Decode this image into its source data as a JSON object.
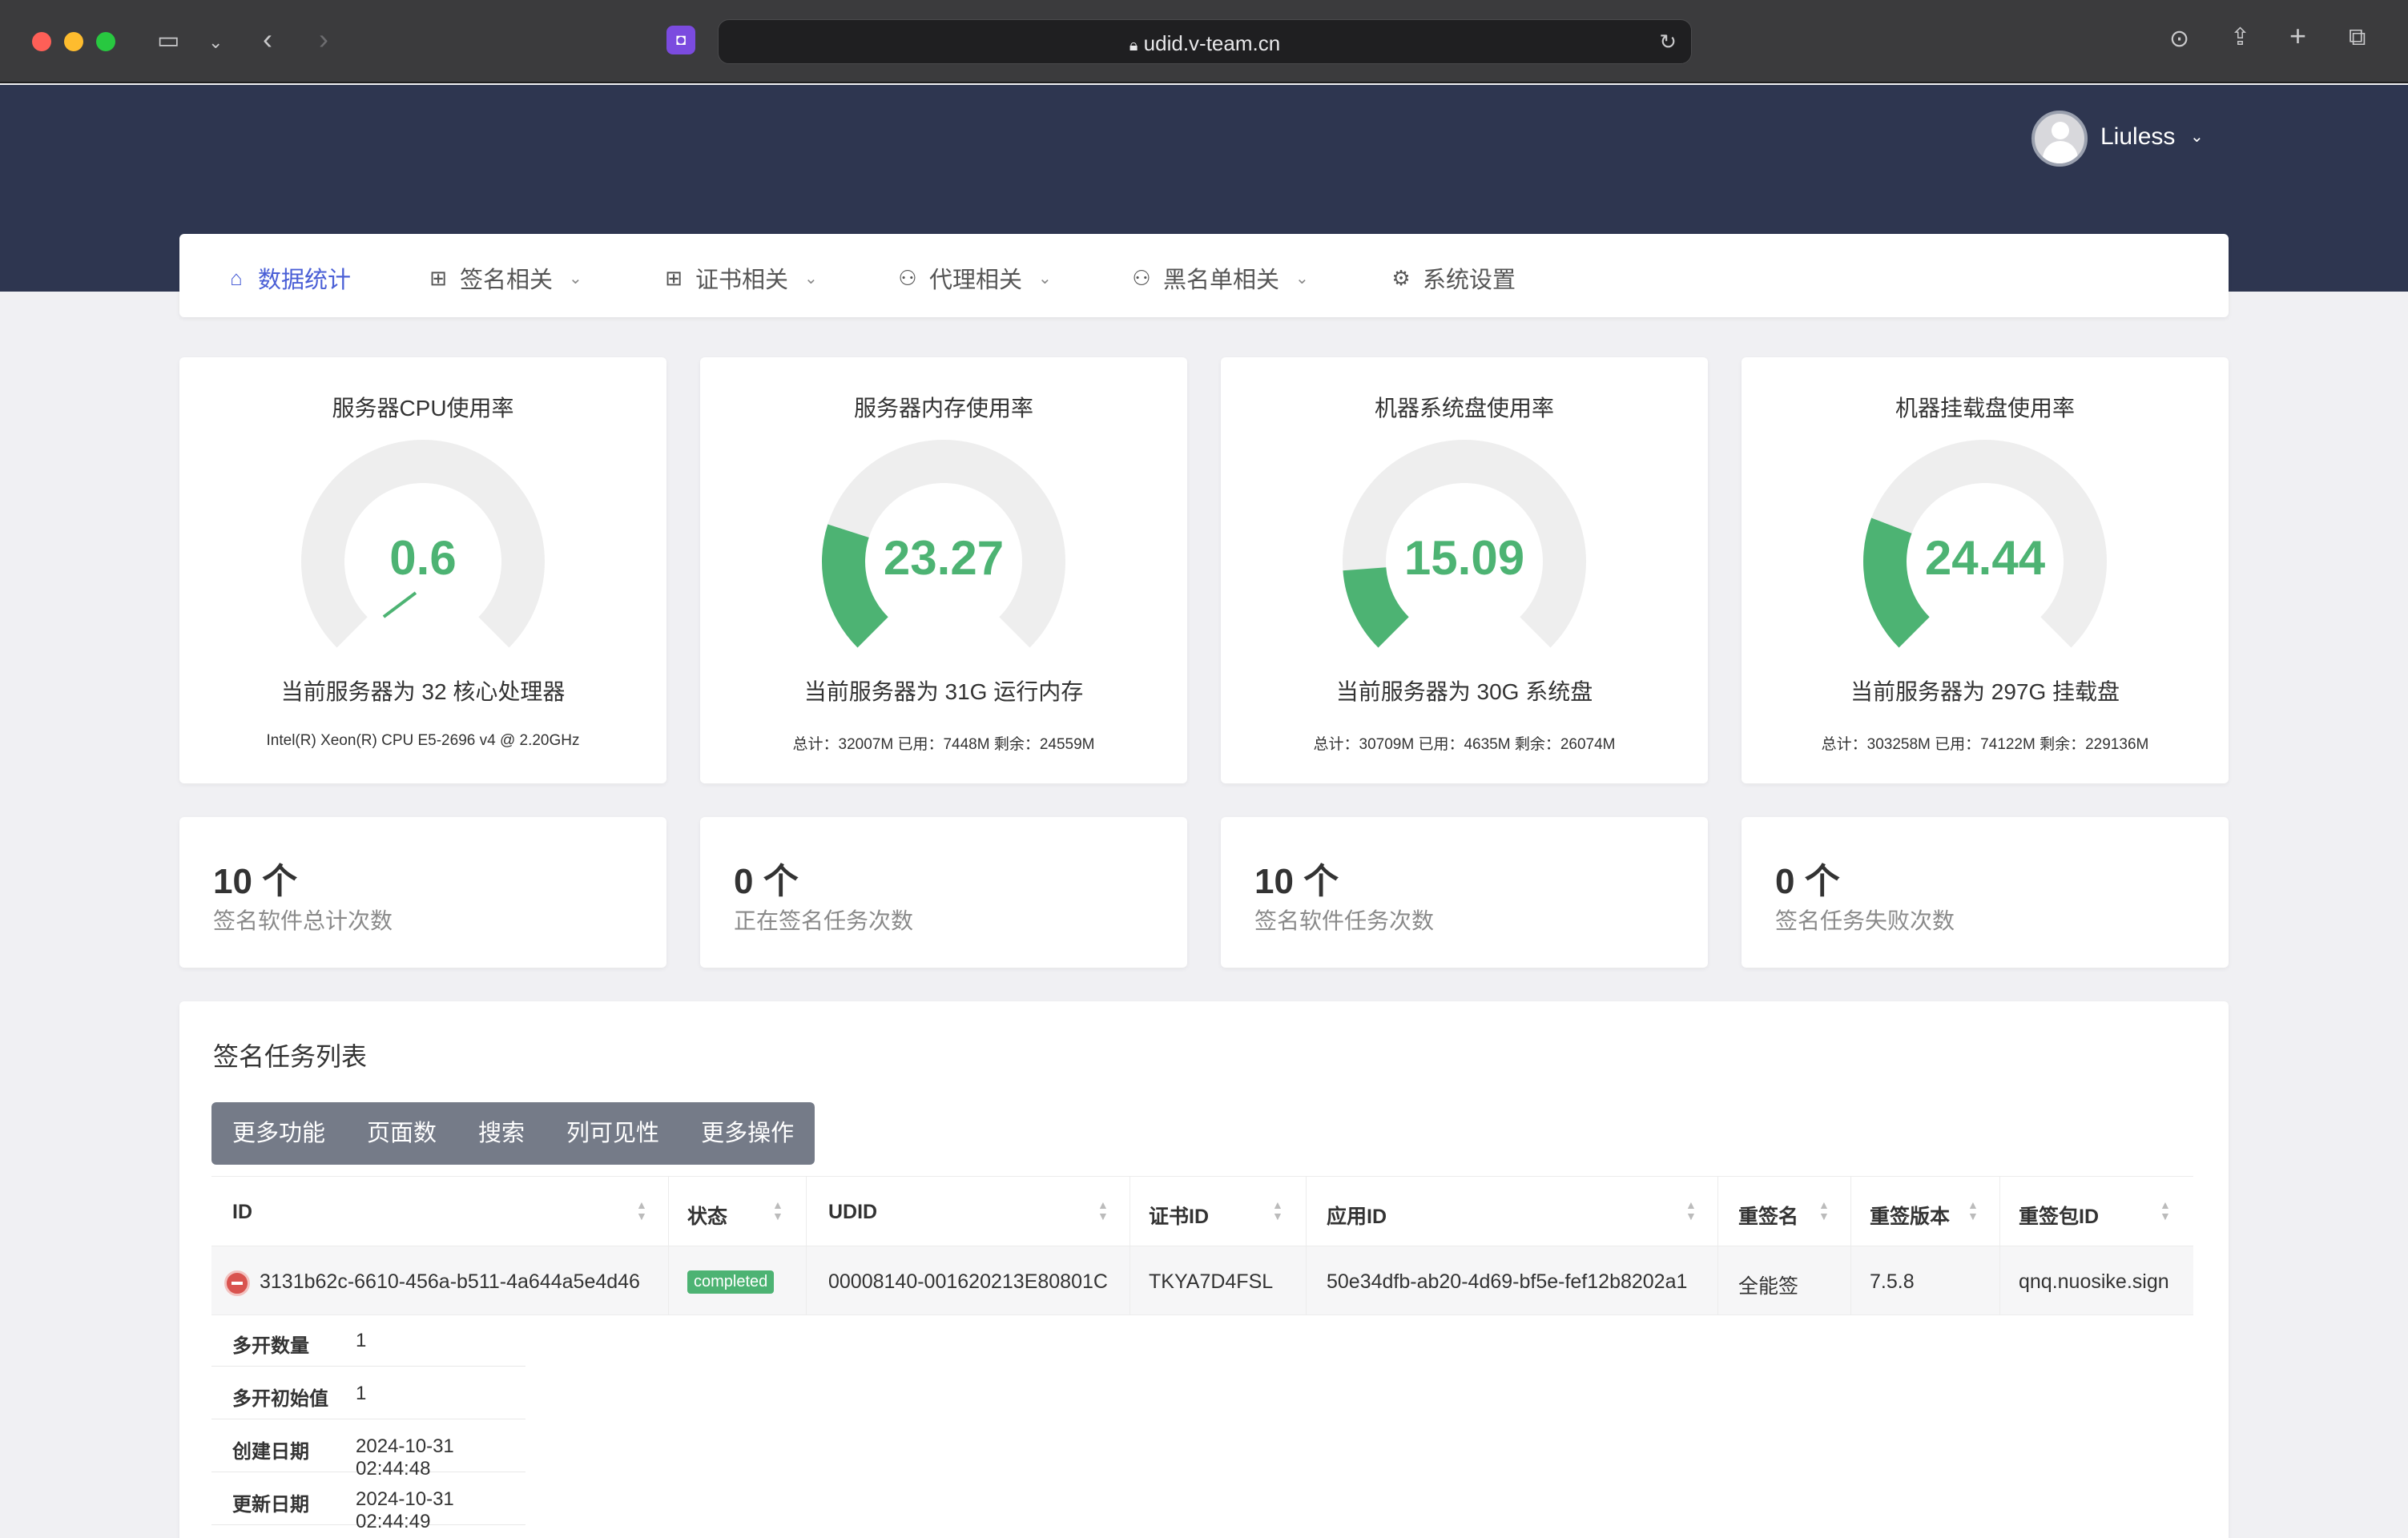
{
  "browser": {
    "url": "udid.v-team.cn"
  },
  "header": {
    "username": "Liuless"
  },
  "nav": {
    "items": [
      {
        "label": "数据统计",
        "icon": "home-icon",
        "glyph": "⌂"
      },
      {
        "label": "签名相关",
        "icon": "grid-icon",
        "glyph": "⊞"
      },
      {
        "label": "证书相关",
        "icon": "grid-icon",
        "glyph": "⊞"
      },
      {
        "label": "代理相关",
        "icon": "users-icon",
        "glyph": "⚇"
      },
      {
        "label": "黑名单相关",
        "icon": "users-icon",
        "glyph": "⚇"
      },
      {
        "label": "系统设置",
        "icon": "gear-icon",
        "glyph": "⚙"
      }
    ]
  },
  "colors": {
    "accent": "#4a5fd6",
    "gauge_fill": "#4db373",
    "gauge_track": "#eeeeee",
    "header_bg": "#2e3650"
  },
  "gauges": [
    {
      "title": "服务器CPU使用率",
      "value": "0.6",
      "percent": 0.6,
      "desc": "当前服务器为 32 核心处理器",
      "sub": "Intel(R) Xeon(R) CPU E5-2696 v4 @ 2.20GHz"
    },
    {
      "title": "服务器内存使用率",
      "value": "23.27",
      "percent": 23.27,
      "desc": "当前服务器为 31G 运行内存",
      "sub": "总计：32007M 已用：7448M 剩余：24559M"
    },
    {
      "title": "机器系统盘使用率",
      "value": "15.09",
      "percent": 15.09,
      "desc": "当前服务器为 30G 系统盘",
      "sub": "总计：30709M 已用：4635M 剩余：26074M"
    },
    {
      "title": "机器挂载盘使用率",
      "value": "24.44",
      "percent": 24.44,
      "desc": "当前服务器为 297G 挂载盘",
      "sub": "总计：303258M 已用：74122M 剩余：229136M"
    }
  ],
  "stats": [
    {
      "value": "10 个",
      "label": "签名软件总计次数"
    },
    {
      "value": "0 个",
      "label": "正在签名任务次数"
    },
    {
      "value": "10 个",
      "label": "签名软件任务次数"
    },
    {
      "value": "0 个",
      "label": "签名任务失败次数"
    }
  ],
  "task_list": {
    "title": "签名任务列表",
    "toolbar": [
      "更多功能",
      "页面数",
      "搜索",
      "列可见性",
      "更多操作"
    ],
    "columns": [
      "ID",
      "状态",
      "UDID",
      "证书ID",
      "应用ID",
      "重签名",
      "重签版本",
      "重签包ID"
    ],
    "rows": [
      {
        "id": "3131b62c-6610-456a-b511-4a644a5e4d46",
        "status": "completed",
        "udid": "00008140-001620213E80801C",
        "cert_id": "TKYA7D4FSL",
        "app_id": "50e34dfb-ab20-4d69-bf5e-fef12b8202a1",
        "resign_name": "全能签",
        "resign_version": "7.5.8",
        "resign_bundle": "qnq.nuosike.sign"
      }
    ],
    "details": [
      {
        "key": "多开数量",
        "value": "1"
      },
      {
        "key": "多开初始值",
        "value": "1"
      },
      {
        "key": "创建日期",
        "value": "2024-10-31 02:44:48"
      },
      {
        "key": "更新日期",
        "value": "2024-10-31 02:44:49"
      }
    ]
  }
}
